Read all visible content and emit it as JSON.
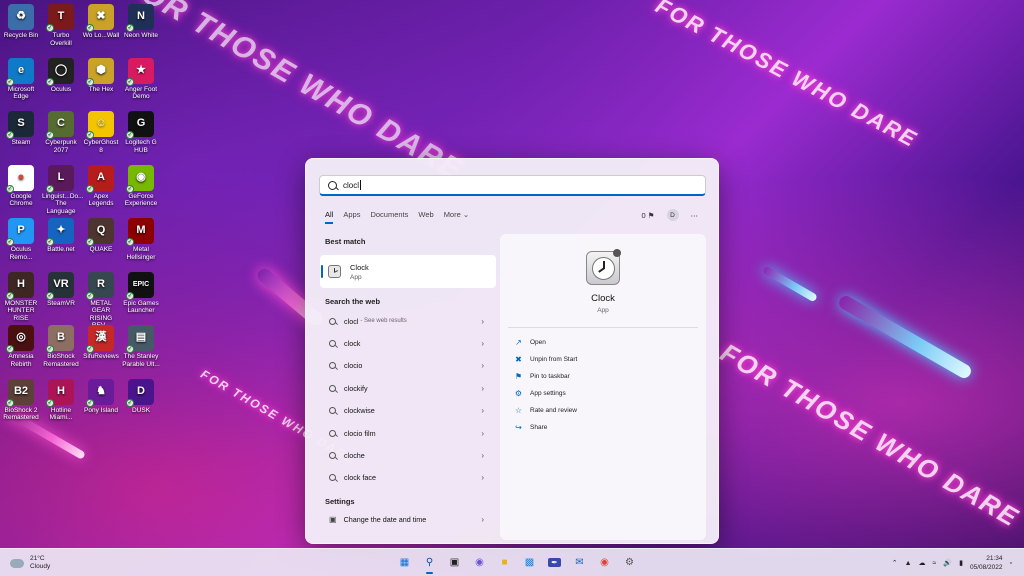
{
  "wallpaper": {
    "slogan": "FOR THOSE WHO DARE"
  },
  "desktop_icons": [
    {
      "label": "Recycle Bin",
      "color": "#3b6ea8",
      "glyph": "♻"
    },
    {
      "label": "Turbo Overkill",
      "color": "#7a1a1a",
      "glyph": "T"
    },
    {
      "label": "Wo Long Fallen Dynasty",
      "display": "Wo Lo...Wall",
      "color": "#c9a227",
      "glyph": "✖"
    },
    {
      "label": "Neon White",
      "color": "#1f2f57",
      "glyph": "N"
    },
    {
      "label": "Microsoft Edge",
      "color": "#0f7bc8",
      "glyph": "e"
    },
    {
      "label": "Oculus",
      "color": "#222222",
      "glyph": "◯"
    },
    {
      "label": "The Hex",
      "color": "#c9a227",
      "glyph": "⬢"
    },
    {
      "label": "Anger Foot Demo",
      "color": "#d81b60",
      "glyph": "★"
    },
    {
      "label": "Steam",
      "color": "#1b2838",
      "glyph": "S"
    },
    {
      "label": "Cyberpunk 2077",
      "color": "#556b2f",
      "glyph": "C"
    },
    {
      "label": "CyberGhost 8",
      "color": "#f2c500",
      "glyph": "☺"
    },
    {
      "label": "Logitech G HUB",
      "color": "#111111",
      "glyph": "G"
    },
    {
      "label": "Google Chrome",
      "color": "#ffffff",
      "glyph": "●"
    },
    {
      "label": "Linguist...Do... The Language",
      "color": "#5a1a5a",
      "glyph": "L"
    },
    {
      "label": "Apex Legends",
      "color": "#b71c1c",
      "glyph": "A"
    },
    {
      "label": "GeForce Experience",
      "color": "#76b900",
      "glyph": "◉"
    },
    {
      "label": "Oculus Remo...",
      "color": "#2196f3",
      "glyph": "P"
    },
    {
      "label": "Battle.net",
      "color": "#1565c0",
      "glyph": "✦"
    },
    {
      "label": "QUAKE",
      "color": "#4e342e",
      "glyph": "Q"
    },
    {
      "label": "Metal Hellsinger",
      "color": "#8b0000",
      "glyph": "M"
    },
    {
      "label": "MONSTER HUNTER RISE",
      "color": "#3e2723",
      "glyph": "H"
    },
    {
      "label": "SteamVR",
      "color": "#263238",
      "glyph": "VR"
    },
    {
      "label": "METAL GEAR RISING REV...",
      "color": "#37474f",
      "glyph": "R"
    },
    {
      "label": "Epic Games Launcher",
      "color": "#111111",
      "glyph": "EPIC"
    },
    {
      "label": "Amnesia Rebirth",
      "color": "#4a1010",
      "glyph": "◎"
    },
    {
      "label": "BioShock Remastered",
      "color": "#8d6e63",
      "glyph": "B"
    },
    {
      "label": "SifuReviews",
      "color": "#c62828",
      "glyph": "漢"
    },
    {
      "label": "The Stanley Parable Ult...",
      "color": "#455a64",
      "glyph": "▤"
    },
    {
      "label": "BioShock 2 Remastered",
      "color": "#5d4037",
      "glyph": "B2"
    },
    {
      "label": "Hotline Miami...",
      "color": "#ad1457",
      "glyph": "H"
    },
    {
      "label": "Pony Island",
      "color": "#6a1b9a",
      "glyph": "♞"
    },
    {
      "label": "DUSK",
      "color": "#4a148c",
      "glyph": "D"
    }
  ],
  "search": {
    "query": "clocl",
    "tabs": [
      "All",
      "Apps",
      "Documents",
      "Web",
      "More ⌄"
    ],
    "points": "0",
    "avatar": "D",
    "more_options": "⋯",
    "best_match_title": "Best match",
    "best_match": {
      "name": "Clock",
      "type": "App"
    },
    "web_title": "Search the web",
    "web_results": [
      {
        "term": "clocl",
        "suffix": "- See web results"
      },
      {
        "term": "clock",
        "suffix": ""
      },
      {
        "term": "clocio",
        "suffix": ""
      },
      {
        "term": "clockify",
        "suffix": ""
      },
      {
        "term": "clockwise",
        "suffix": ""
      },
      {
        "term": "clocio film",
        "suffix": ""
      },
      {
        "term": "cloche",
        "suffix": ""
      },
      {
        "term": "clock face",
        "suffix": ""
      }
    ],
    "settings_title": "Settings",
    "settings_result": "Change the date and time",
    "detail": {
      "name": "Clock",
      "type": "App",
      "actions": [
        {
          "label": "Open",
          "icon": "open-icon"
        },
        {
          "label": "Unpin from Start",
          "icon": "unpin-icon"
        },
        {
          "label": "Pin to taskbar",
          "icon": "pin-icon"
        },
        {
          "label": "App settings",
          "icon": "gear-icon"
        },
        {
          "label": "Rate and review",
          "icon": "star-icon"
        },
        {
          "label": "Share",
          "icon": "share-icon"
        }
      ]
    }
  },
  "taskbar": {
    "weather_temp": "21°C",
    "weather_desc": "Cloudy",
    "time": "21:34",
    "date": "05/08/2022",
    "accent": "#0067c0"
  }
}
